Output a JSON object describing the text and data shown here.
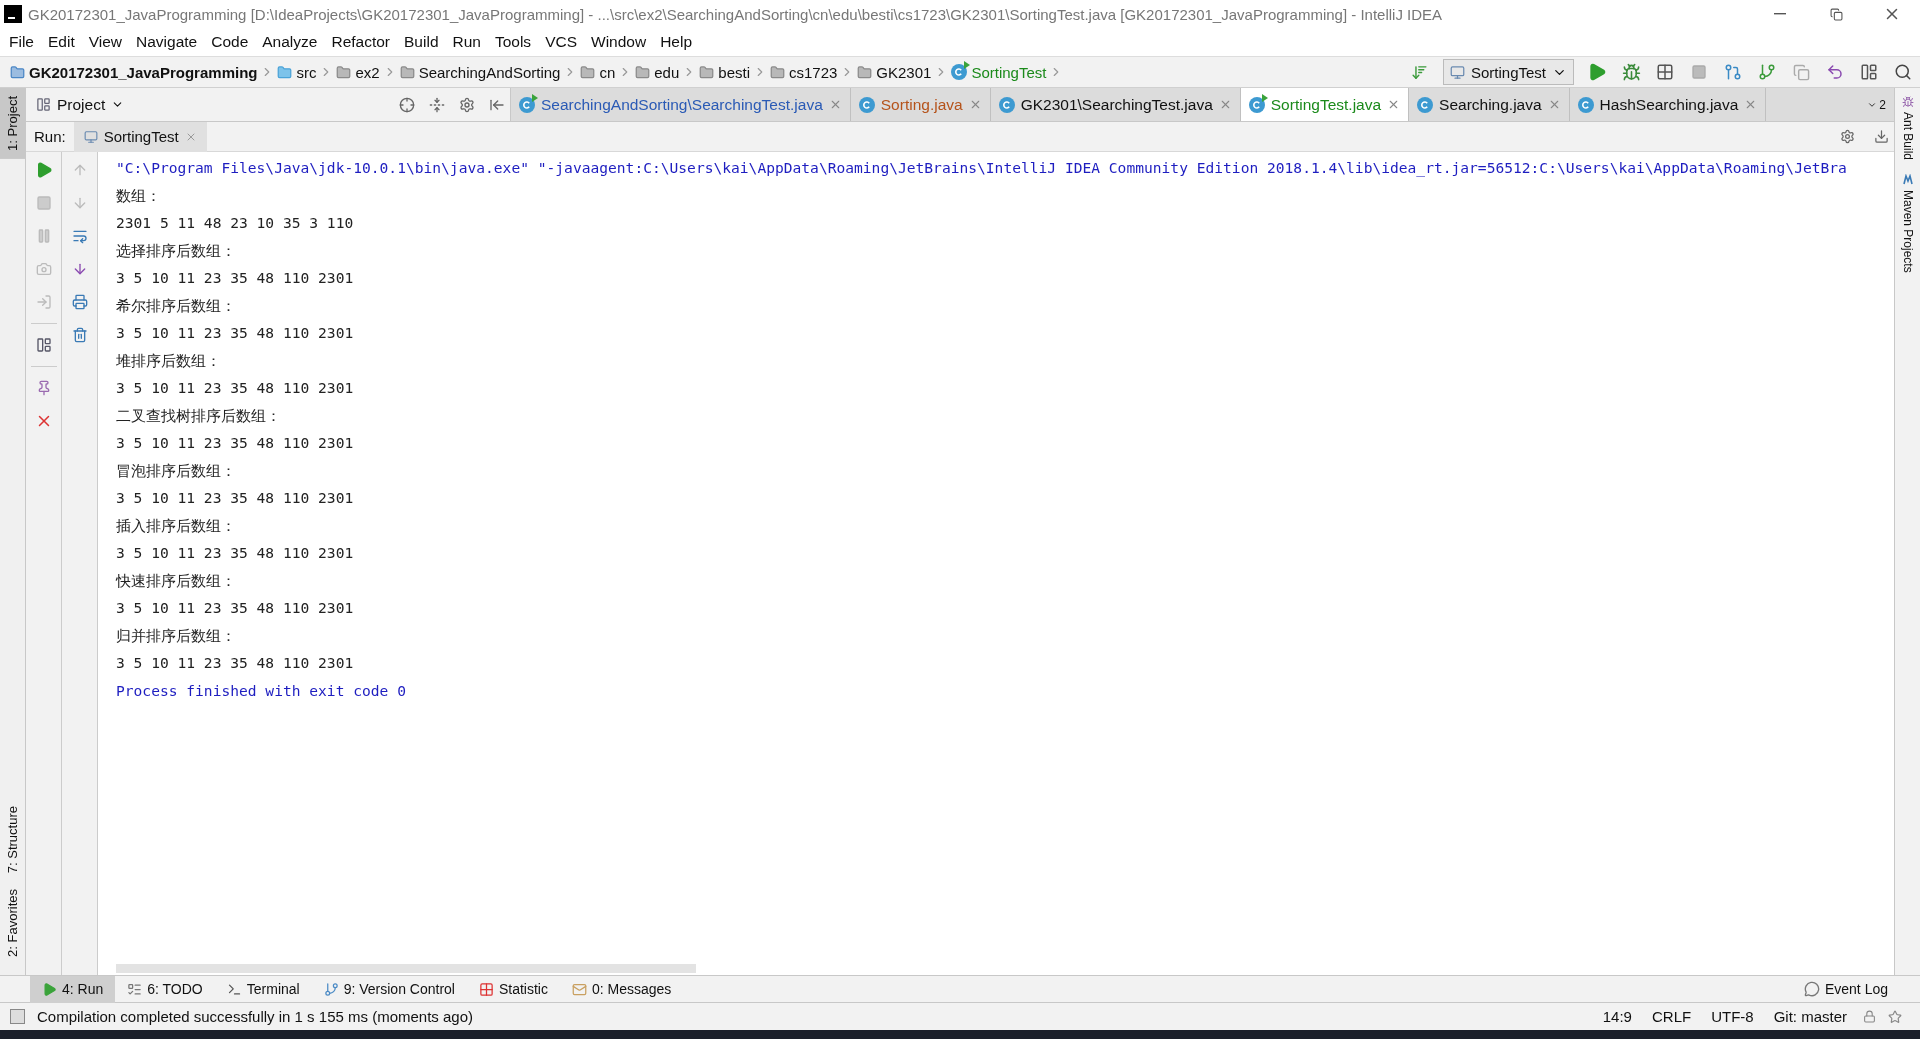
{
  "window": {
    "title": "GK20172301_JavaProgramming [D:\\IdeaProjects\\GK20172301_JavaProgramming] - ...\\src\\ex2\\SearchingAndSorting\\cn\\edu\\besti\\cs1723\\GK2301\\SortingTest.java [GK20172301_JavaProgramming] - IntelliJ IDEA"
  },
  "menu": [
    "File",
    "Edit",
    "View",
    "Navigate",
    "Code",
    "Analyze",
    "Refactor",
    "Build",
    "Run",
    "Tools",
    "VCS",
    "Window",
    "Help"
  ],
  "breadcrumbs": [
    {
      "label": "GK20172301_JavaProgramming",
      "kind": "project"
    },
    {
      "label": "src",
      "kind": "source"
    },
    {
      "label": "ex2",
      "kind": "folder"
    },
    {
      "label": "SearchingAndSorting",
      "kind": "folder"
    },
    {
      "label": "cn",
      "kind": "folder"
    },
    {
      "label": "edu",
      "kind": "folder"
    },
    {
      "label": "besti",
      "kind": "folder"
    },
    {
      "label": "cs1723",
      "kind": "folder"
    },
    {
      "label": "GK2301",
      "kind": "folder"
    },
    {
      "label": "SortingTest",
      "kind": "class"
    }
  ],
  "run_config": "SortingTest",
  "left_strip": {
    "top": [
      {
        "label": "1: Project",
        "selected": true
      }
    ],
    "bottom": [
      {
        "label": "7: Structure",
        "selected": false
      },
      {
        "label": "2: Favorites",
        "selected": false
      }
    ]
  },
  "right_strip": [
    "Ant Build",
    "Maven Projects"
  ],
  "project_panel": {
    "title": "Project"
  },
  "editor_tabs": [
    {
      "label": "SearchingAndSorting\\SearchingTest.java",
      "selected": false,
      "color": "#2a5ab5",
      "runnable": true
    },
    {
      "label": "Sorting.java",
      "selected": false,
      "color": "#b5531b",
      "runnable": false
    },
    {
      "label": "GK2301\\SearchingTest.java",
      "selected": false,
      "color": "#111111",
      "runnable": false
    },
    {
      "label": "SortingTest.java",
      "selected": true,
      "color": "#1b8a1b",
      "runnable": true
    },
    {
      "label": "Searching.java",
      "selected": false,
      "color": "#111111",
      "runnable": false
    },
    {
      "label": "HashSearching.java",
      "selected": false,
      "color": "#111111",
      "runnable": false
    }
  ],
  "tab_overflow": "2",
  "run_panel": {
    "label": "Run:",
    "tabs": [
      {
        "label": "SortingTest",
        "selected": true
      }
    ]
  },
  "console": [
    {
      "kind": "command",
      "text": "\"C:\\Program Files\\Java\\jdk-10.0.1\\bin\\java.exe\" \"-javaagent:C:\\Users\\kai\\AppData\\Roaming\\JetBrains\\IntelliJ IDEA Community Edition 2018.1.4\\lib\\idea_rt.jar=56512:C:\\Users\\kai\\AppData\\Roaming\\JetBra"
    },
    {
      "kind": "output",
      "text": "数组："
    },
    {
      "kind": "output",
      "text": "2301 5 11 48 23 10 35 3 110"
    },
    {
      "kind": "output",
      "text": "选择排序后数组："
    },
    {
      "kind": "output",
      "text": "3 5 10 11 23 35 48 110 2301"
    },
    {
      "kind": "output",
      "text": "希尔排序后数组："
    },
    {
      "kind": "output",
      "text": "3 5 10 11 23 35 48 110 2301"
    },
    {
      "kind": "output",
      "text": "堆排序后数组："
    },
    {
      "kind": "output",
      "text": "3 5 10 11 23 35 48 110 2301"
    },
    {
      "kind": "output",
      "text": "二叉查找树排序后数组："
    },
    {
      "kind": "output",
      "text": "3 5 10 11 23 35 48 110 2301"
    },
    {
      "kind": "output",
      "text": "冒泡排序后数组："
    },
    {
      "kind": "output",
      "text": "3 5 10 11 23 35 48 110 2301"
    },
    {
      "kind": "output",
      "text": "插入排序后数组："
    },
    {
      "kind": "output",
      "text": "3 5 10 11 23 35 48 110 2301"
    },
    {
      "kind": "output",
      "text": "快速排序后数组："
    },
    {
      "kind": "output",
      "text": "3 5 10 11 23 35 48 110 2301"
    },
    {
      "kind": "output",
      "text": "归并排序后数组："
    },
    {
      "kind": "output",
      "text": "3 5 10 11 23 35 48 110 2301"
    },
    {
      "kind": "system",
      "text": "Process finished with exit code 0"
    }
  ],
  "tool_tabs": [
    {
      "label": "4: Run",
      "selected": true,
      "kind": "run"
    },
    {
      "label": "6: TODO",
      "selected": false,
      "kind": "todo"
    },
    {
      "label": "Terminal",
      "selected": false,
      "kind": "terminal"
    },
    {
      "label": "9: Version Control",
      "selected": false,
      "kind": "vcs"
    },
    {
      "label": "Statistic",
      "selected": false,
      "kind": "statistic"
    },
    {
      "label": "0: Messages",
      "selected": false,
      "kind": "messages"
    }
  ],
  "event_log": "Event Log",
  "status_bar": {
    "message": "Compilation completed successfully in 1 s 155 ms (moments ago)",
    "position": "14:9",
    "line_separator": "CRLF",
    "encoding": "UTF-8",
    "vcs": "Git: master"
  }
}
